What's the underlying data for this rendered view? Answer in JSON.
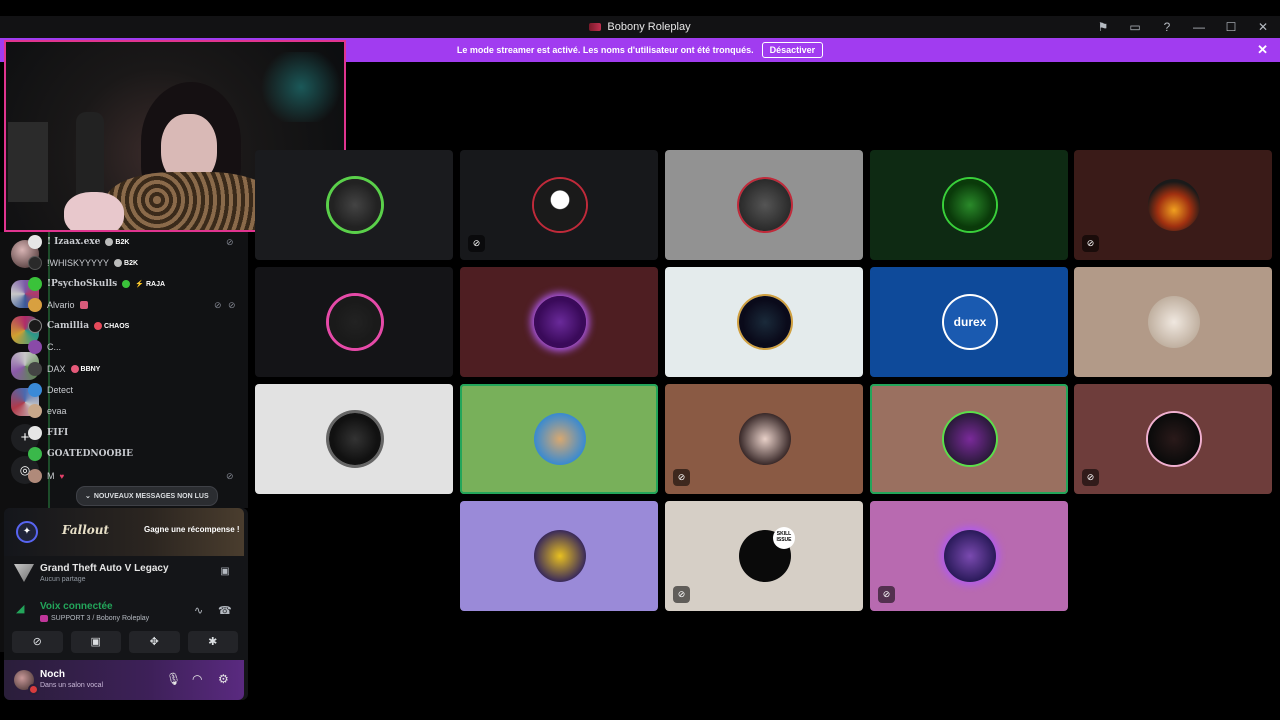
{
  "window": {
    "title": "Bobony Roleplay"
  },
  "banner": {
    "message": "Le mode streamer est activé. Les noms d'utilisateur ont été tronqués.",
    "button_label": "Désactiver"
  },
  "members": [
    {
      "name": "! Izaax.exe",
      "tag": "B2K"
    },
    {
      "name": "!WHISKYYYYY",
      "tag": "B2K"
    },
    {
      "name": "!PsychoSkulls",
      "tag": "RAJA"
    },
    {
      "name": "Alvario",
      "tag": ""
    },
    {
      "name": "Camillia",
      "tag": "CHAOS"
    },
    {
      "name": "C...",
      "tag": ""
    },
    {
      "name": "DAX",
      "tag": "BBNY"
    },
    {
      "name": "Detect",
      "tag": ""
    },
    {
      "name": "evaa",
      "tag": ""
    },
    {
      "name": "FIFI",
      "tag": ""
    },
    {
      "name": "GOATEDNOOBIE",
      "tag": ""
    },
    {
      "name": "M",
      "tag": ""
    }
  ],
  "unread_label": "NOUVEAUX MESSAGES NON LUS",
  "promo": {
    "logo": "Fallout",
    "cta": "Gagne une récompense !"
  },
  "activity": {
    "title": "Grand Theft Auto V Legacy",
    "subtitle": "Aucun partage"
  },
  "voice": {
    "status": "Voix connectée",
    "channel": "SUPPORT 3 / Bobony Roleplay"
  },
  "user": {
    "name": "Noch",
    "status": "Dans un salon vocal"
  },
  "tile_avatars": [
    {
      "name": "durex",
      "label": "durex"
    },
    {
      "name": "skill-issue",
      "label": "SKILL ISSUE"
    }
  ],
  "colors": {
    "banner": "#a13cf0",
    "speaking_border": "#23a55a",
    "voice_connected": "#23a55a",
    "webcam_border": "#e0348f"
  }
}
